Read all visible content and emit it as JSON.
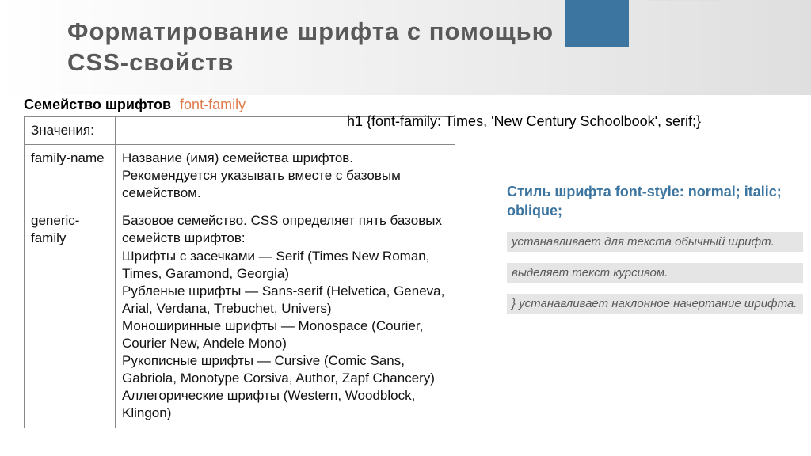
{
  "title_line1": "Форматирование шрифта с помощью",
  "title_line2": "CSS-свойств",
  "family": {
    "heading": "Семейство шрифтов",
    "property": "font-family",
    "row0": {
      "k": "Значения:",
      "v": ""
    },
    "row1": {
      "k": "family-name",
      "v": "Название (имя) семейства шрифтов. Рекомендуется указывать вместе с базовым семейством."
    },
    "row2": {
      "k": "generic-family",
      "v": "Базовое семейство. CSS определяет пять базовых семейств шрифтов:\nШрифты с засечками — Serif (Times New Roman, Times, Garamond, Georgia)\nРубленые шрифты — Sans-serif (Helvetica, Geneva, Arial, Verdana, Trebuchet, Univers)\nМоноширинные шрифты — Monospace (Courier, Courier New, Andele Mono)\nРукописные шрифты — Cursive (Comic Sans, Gabriola, Monotype Corsiva, Author, Zapf Chancery)\nАллегорические шрифты (Western, Woodblock, Klingon)"
    }
  },
  "code": "h1 {font-family: Times, 'New Century Schoolbook', serif;}",
  "font_style": {
    "heading": "Стиль шрифта font-style: normal; italic;\noblique;",
    "strips": [
      "устанавливает для текста обычный шрифт.",
      "выделяет текст курсивом.",
      "} устанавливает наклонное начертание шрифта."
    ]
  }
}
